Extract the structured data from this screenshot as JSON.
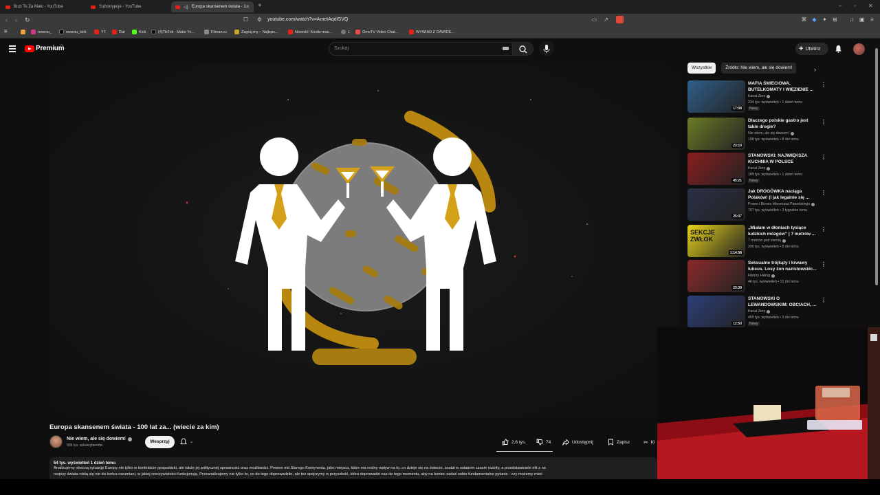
{
  "browser": {
    "tabs": [
      {
        "label": "Buzi To Za Mało - YouTube",
        "active": false
      },
      {
        "label": "Subskrypcje - YouTube",
        "active": false
      },
      {
        "label": "Europa skansenem świata - 1",
        "active": true
      }
    ],
    "new_tab_icon": "+",
    "url": "youtube.com/watch?v=AmeIAqdISVQ",
    "bookmarks": [
      {
        "label": "",
        "color": "#e8a33a"
      },
      {
        "label": "nowciu_",
        "color": "#d6338a"
      },
      {
        "label": "nowciu_kick",
        "color": "#222222"
      },
      {
        "label": "YT",
        "color": "#e62117"
      },
      {
        "label": "Rat",
        "color": "#e62117"
      },
      {
        "label": "Kick",
        "color": "#53fc18"
      },
      {
        "label": "(4)TikTok - Make Yo...",
        "color": "#111111"
      },
      {
        "label": "Filman.cc",
        "color": "#888888"
      },
      {
        "label": "Zagraj.my – Najleps...",
        "color": "#c9a227"
      },
      {
        "label": "Nowość! Kostki mas...",
        "color": "#e62117"
      },
      {
        "label": "1",
        "color": "#777777"
      },
      {
        "label": "OmeTV Video Chat...",
        "color": "#e44d4d"
      },
      {
        "label": "WYWIAD Z DAWIDE...",
        "color": "#e62117"
      }
    ]
  },
  "header": {
    "logo_text": "Premium",
    "logo_region": "PL",
    "search_placeholder": "Szukaj",
    "create_label": "Utwórz"
  },
  "video": {
    "title": "Europa skansenem świata - 100 lat za... (wiecie za kim)",
    "channel_name": "Nie wiem, ale się dowiem!",
    "channel_subs": "909 tys. subskrybentów",
    "support_label": "Wesprzyj",
    "likes": "2,6 tys.",
    "dislikes": "74",
    "share_label": "Udostępnij",
    "save_label": "Zapisz",
    "clip_label": "Kl",
    "views_date": "54 tys. wyświetleń  1 dzień temu",
    "description_line1": "Analizujemy obecną sytuację Europy nie tylko w kontekście gospodarki, ale także jej politycznej sprawności oraz możliwości. Pewien mit Starego Kontynentu, jako miejsca, które ma realny wpływ na to, co dzieje się na świecie, został w ostatnim czasie rozbity, a przedstawiciele elit z na",
    "description_line2": "rozpisy świata robią się nie do końca rozumiani, w jakiej rzeczywistości funkcjonują. Przeanalizujemy nie tylko to, co do tego doprowadziło, ale też spojrzymy w przyszłość, która doprowadzi nas do tego momentu, aby na koniec zadać sobie fundamentalne pytanie - czy możemy mieć"
  },
  "sidebar": {
    "chips": [
      "Wszystkie",
      "Źródło: Nie wiem, ale się dowiem!"
    ],
    "recommendations": [
      {
        "title": "MAFIA ŚMIECIOWA, BUTELKOMATY I WIĘZIENIE ...",
        "channel": "Kanał Zero",
        "meta": "234 tys. wyświetleń • 1 dzień temu",
        "badge": "Nowy",
        "duration": "17:08",
        "thumb_color": "#2f5f8a"
      },
      {
        "title": "Dlaczego polskie gastro jest takie drogie?",
        "channel": "Nie wiem, ale się dowiem!",
        "meta": "198 tys. wyświetleń • 8 dni temu",
        "badge": "",
        "duration": "23:10",
        "thumb_color": "#6b7d24"
      },
      {
        "title": "STANOWSKI: NAJWIĘKSZA KUCHNIA W POLSCE",
        "channel": "Kanał Zero",
        "meta": "189 tys. wyświetleń • 1 dzień temu",
        "badge": "Nowy",
        "duration": "45:21",
        "thumb_color": "#8a1f1f"
      },
      {
        "title": "Jak DROGÓWKA naciąga Polaków! (i jak legalnie się ...",
        "channel": "Prawo i Biznes Mecenasa Pawelskiego",
        "meta": "707 tys. wyświetleń • 3 tygodnie temu",
        "badge": "",
        "duration": "25:37",
        "thumb_color": "#2a2f46"
      },
      {
        "title": "„Miałam w dłoniach tysiące ludzkich mózgów” | 7 metrów ...",
        "channel": "7 metrów pod ziemią",
        "meta": "200 tys. wyświetleń • 8 dni temu",
        "badge": "",
        "duration": "1:14:58",
        "thumb_color": "#e6d21a",
        "thumb_text": "SEKCJE ZWŁOK"
      },
      {
        "title": "Seksualne trójkąty i krwawy luksus. Losy żon nazistowskic...",
        "channel": "History Hiking",
        "meta": "46 tys. wyświetleń • 10 dni temu",
        "badge": "",
        "duration": "23:39",
        "thumb_color": "#8c2a2a"
      },
      {
        "title": "STANOWSKI O LEWANDOWSKIM: OBCIACH, ...",
        "channel": "Kanał Zero",
        "meta": "450 tys. wyświetleń • 3 dni temu",
        "badge": "Nowy",
        "duration": "12:53",
        "thumb_color": "#2d3f7a"
      }
    ]
  },
  "colors": {
    "bg": "#0f0f0f",
    "accent_gold": "#d4a017",
    "yt_red": "#ff0000"
  },
  "icons": [
    "hamburger-icon",
    "search-icon",
    "mic-icon",
    "plus-icon",
    "bell-icon",
    "like-icon",
    "dislike-icon",
    "share-icon",
    "save-icon",
    "clip-icon"
  ]
}
